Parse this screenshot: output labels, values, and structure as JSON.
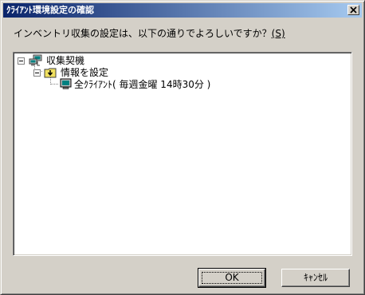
{
  "window": {
    "title": "ｸﾗｲｱﾝﾄ環境設定の確認",
    "close_symbol": "×"
  },
  "question": {
    "text": "インベントリ収集の設定は、以下の通りでよろしいですか？",
    "accel": "(S)"
  },
  "tree": {
    "root": {
      "label": "収集契機",
      "icon": "network-computers-icon",
      "expanded": true
    },
    "child": {
      "label": "情報を設定",
      "icon": "download-folder-icon",
      "expanded": true
    },
    "leaf": {
      "label": "全ｸﾗｲｱﾝﾄ( 毎週金曜 14時30分 )",
      "icon": "computer-monitor-icon"
    }
  },
  "buttons": {
    "ok": "OK",
    "cancel": "ｷｬﾝｾﾙ"
  },
  "colors": {
    "titlebar_start": "#0a246a",
    "titlebar_end": "#a6caf0",
    "dialog_face": "#d4d0c8",
    "folder_yellow": "#f0e060",
    "monitor_teal": "#008080"
  }
}
